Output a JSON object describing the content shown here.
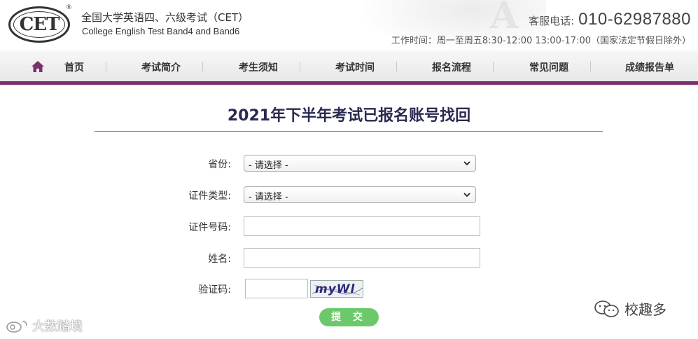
{
  "header": {
    "logo_text": "CET",
    "logo_reg": "®",
    "site_name_cn": "全国大学英语四、六级考试（CET）",
    "site_name_en": "College English Test Band4 and Band6",
    "hotline_label": "客服电话:",
    "hotline_number": "010-62987880",
    "hours": "工作时间：周一至周五8:30-12:00 13:00-17:00（国家法定节假日除外）"
  },
  "nav": {
    "items": [
      "首页",
      "考试简介",
      "考生须知",
      "考试时间",
      "报名流程",
      "常见问题",
      "成绩报告单"
    ]
  },
  "page": {
    "title": "2021年下半年考试已报名账号找回"
  },
  "form": {
    "province_label": "省份:",
    "province_value": "- 请选择 -",
    "id_type_label": "证件类型:",
    "id_type_value": "- 请选择 -",
    "id_number_label": "证件号码:",
    "id_number_value": "",
    "name_label": "姓名:",
    "name_value": "",
    "captcha_label": "验证码:",
    "captcha_value": "",
    "captcha_image_text": "myWl",
    "submit_label": "提 交"
  },
  "watermarks": {
    "left": "大数踏境",
    "right": "校趣多"
  },
  "colors": {
    "accent": "#7a2f6e",
    "title": "#2a2a50",
    "submit": "#6cc96b"
  },
  "icons": [
    "home-icon",
    "chevron-down-icon",
    "wechat-icon",
    "weibo-icon"
  ]
}
